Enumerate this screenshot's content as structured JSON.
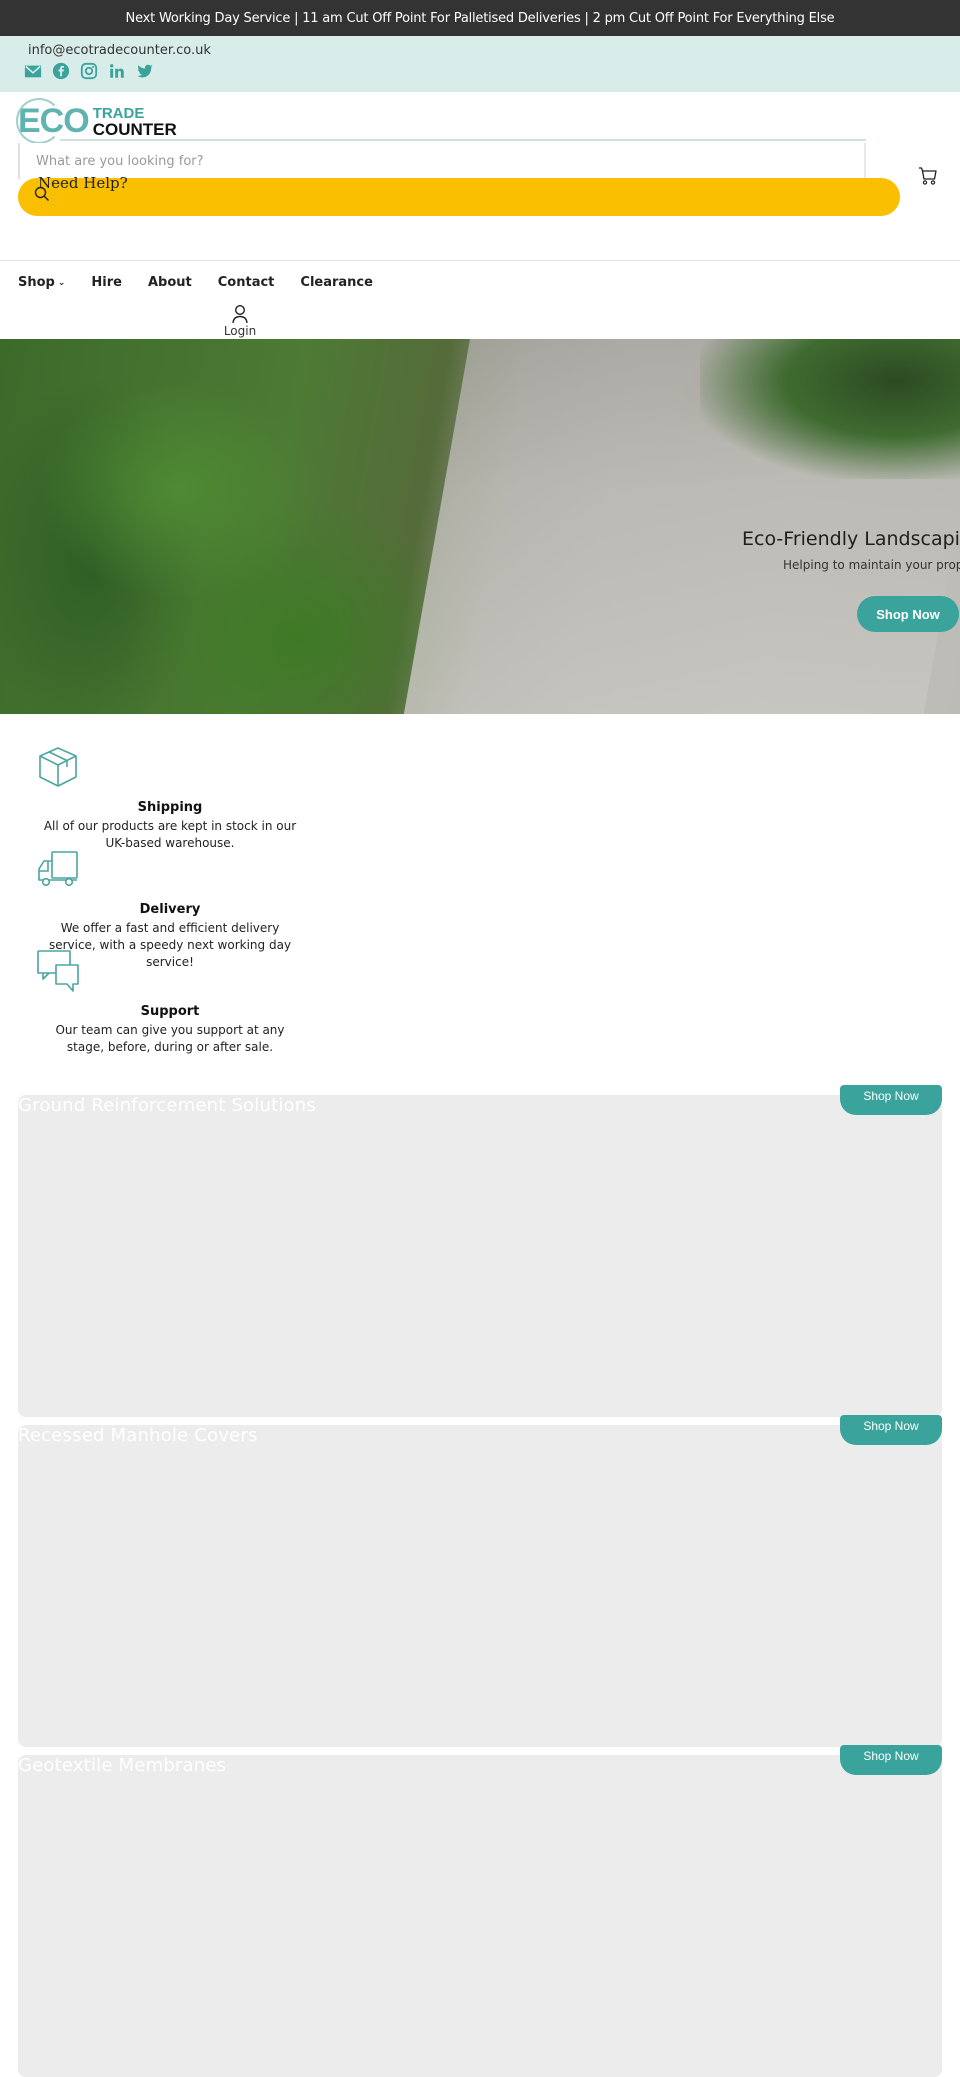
{
  "announcement": "Next Working Day Service | 11 am Cut Off Point For Palletised Deliveries | 2 pm Cut Off Point For Everything Else",
  "contact": {
    "email": "info@ecotradecounter.co.uk",
    "socials": [
      "email-icon",
      "facebook-icon",
      "instagram-icon",
      "linkedin-icon",
      "twitter-icon"
    ]
  },
  "logo": {
    "eco": "ECO",
    "trade": "TRADE",
    "counter": "COUNTER"
  },
  "search": {
    "placeholder": "What are you looking for?",
    "value": ""
  },
  "help": {
    "label": "Need Help?"
  },
  "nav": {
    "items": [
      {
        "label": "Shop",
        "has_dropdown": true
      },
      {
        "label": "Hire"
      },
      {
        "label": "About"
      },
      {
        "label": "Contact"
      },
      {
        "label": "Clearance"
      }
    ],
    "login_label": "Login"
  },
  "hero": {
    "title": "Eco-Friendly Landscaping",
    "subtitle": "Helping to maintain your property",
    "button": "Shop Now"
  },
  "features": [
    {
      "icon": "box-icon",
      "title": "Shipping",
      "desc": "All of our products are kept in stock in our UK-based warehouse."
    },
    {
      "icon": "truck-icon",
      "title": "Delivery",
      "desc": "We offer a fast and efficient delivery service, with a speedy next working day service!"
    },
    {
      "icon": "chat-icon",
      "title": "Support",
      "desc": "Our team can give you support at any stage, before, during or after sale."
    }
  ],
  "categories": [
    {
      "title": "Ground Reinforcement Solutions",
      "button": "Shop Now"
    },
    {
      "title": "Recessed Manhole Covers",
      "button": "Shop Now"
    },
    {
      "title": "Geotextile Membranes",
      "button": "Shop Now"
    }
  ],
  "colors": {
    "accent": "#3aa39c",
    "help_bar": "#f9bf00",
    "announce_bg": "#333333",
    "contact_bg": "#d8ecea",
    "card_bg": "#ececec"
  }
}
